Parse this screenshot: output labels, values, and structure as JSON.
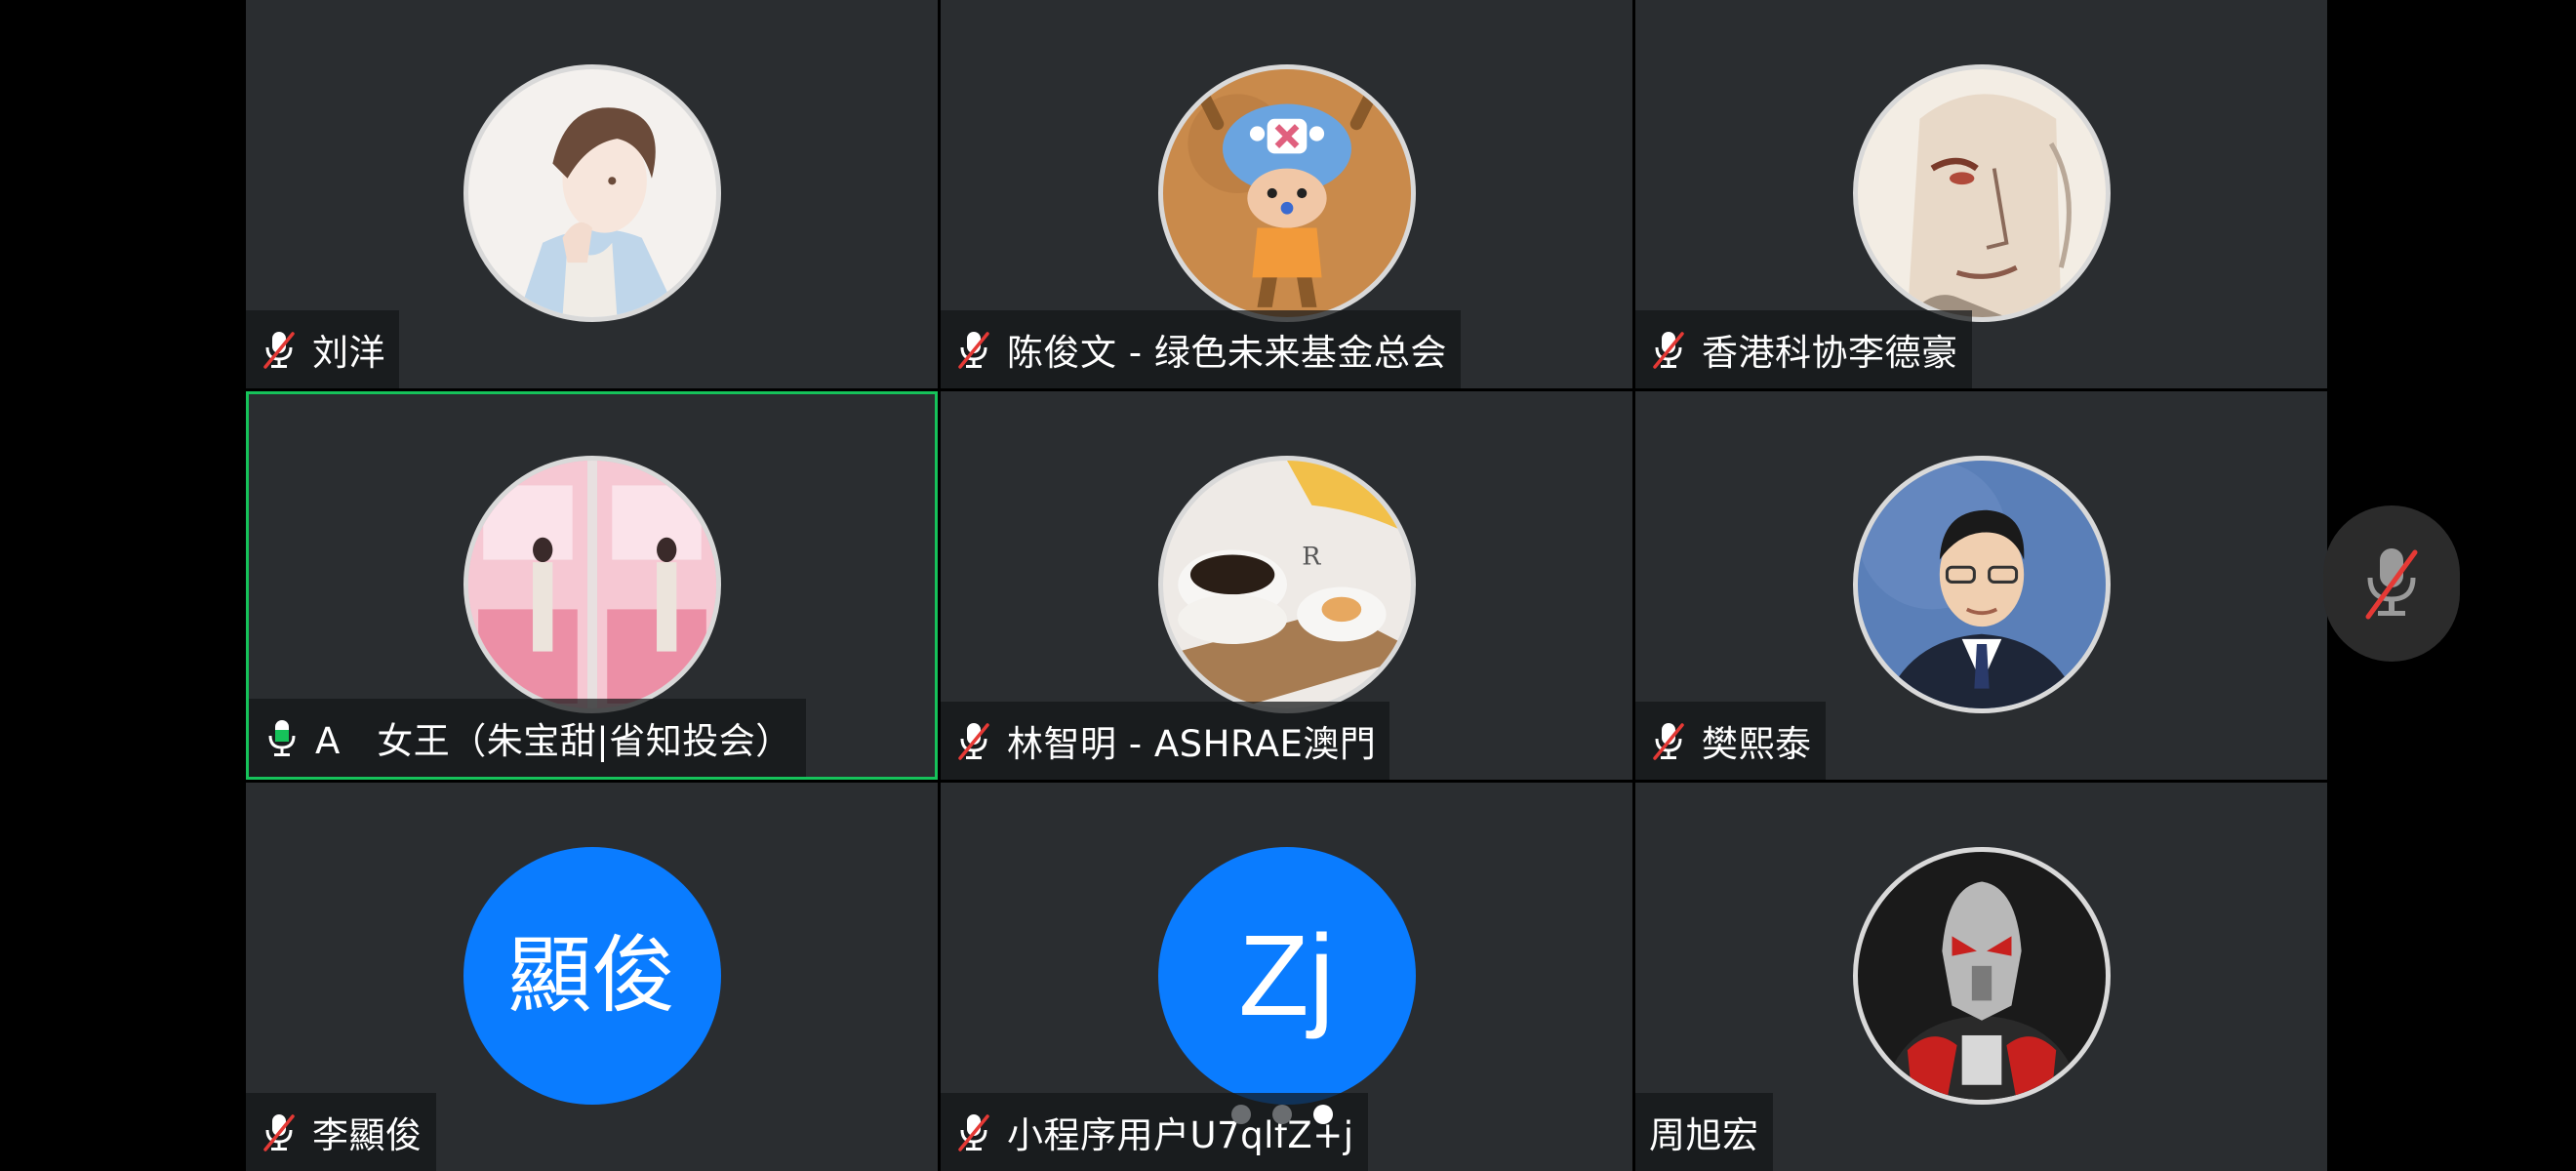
{
  "meeting": {
    "participants": [
      {
        "name": "刘洋",
        "mic": "muted",
        "avatar": "photo-anime-boy"
      },
      {
        "name": "陈俊文 - 绿色未来基金总会",
        "mic": "muted",
        "avatar": "photo-chopper-figure"
      },
      {
        "name": "香港科协李德豪",
        "mic": "muted",
        "avatar": "photo-manga-face"
      },
      {
        "name": "A　女王（朱宝甜|省知投会）",
        "mic": "on",
        "avatar": "photo-pink-wall",
        "active_speaker": true
      },
      {
        "name": "林智明 - ASHRAE澳門",
        "mic": "muted",
        "avatar": "photo-coffee"
      },
      {
        "name": "樊熙泰",
        "mic": "muted",
        "avatar": "photo-man-suit"
      },
      {
        "name": "李顯俊",
        "mic": "muted",
        "avatar_text": "顯俊"
      },
      {
        "name": "小程序用户U7qlfZ+j",
        "mic": "muted",
        "avatar_text": "Zj"
      },
      {
        "name": "周旭宏",
        "mic": "none",
        "avatar": "photo-masked-rider"
      }
    ],
    "page_indicator": {
      "total": 3,
      "current": 3
    },
    "self_mic": "muted"
  },
  "colors": {
    "tile_bg": "#2a2d30",
    "active_border": "#16c25a",
    "initials_bg": "#0a7cff",
    "mute_red": "#e53935",
    "mic_green": "#16c25a"
  }
}
